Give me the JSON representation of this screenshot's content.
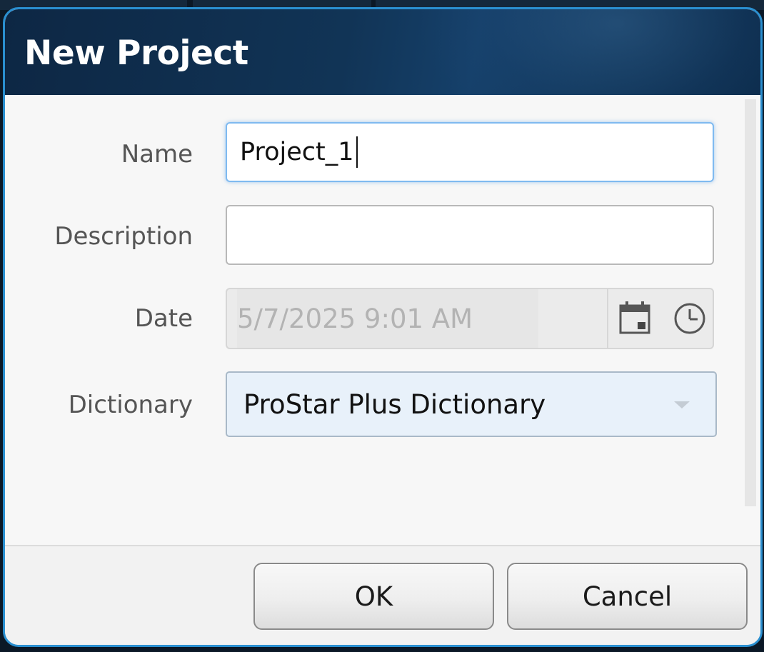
{
  "dialog": {
    "title": "New Project"
  },
  "form": {
    "name_label": "Name",
    "name_value": "Project_1",
    "description_label": "Description",
    "description_value": "",
    "date_label": "Date",
    "date_value": "5/7/2025 9:01 AM",
    "dictionary_label": "Dictionary",
    "dictionary_value": "ProStar Plus Dictionary"
  },
  "buttons": {
    "ok_label": "OK",
    "cancel_label": "Cancel"
  },
  "icons": {
    "calendar": "calendar-icon",
    "clock": "clock-icon",
    "dropdown": "chevron-down-icon"
  },
  "colors": {
    "title_bar": "#113456",
    "dialog_border": "#2a8fd0",
    "focus_border": "#7fbaf0",
    "dropdown_bg": "#e8f1fa"
  }
}
